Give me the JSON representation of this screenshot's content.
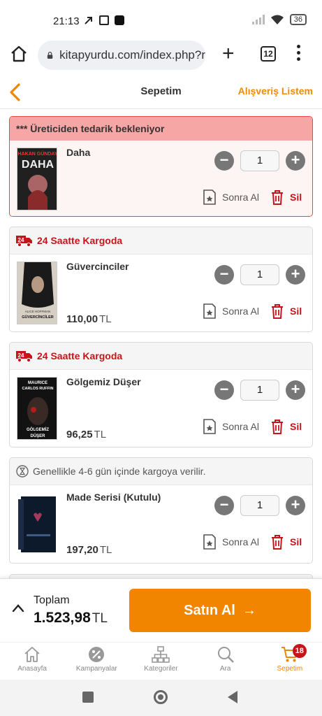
{
  "status_bar": {
    "time": "21:13",
    "battery": "36"
  },
  "browser": {
    "url": "kitapyurdu.com/index.php?r",
    "tab_count": "12"
  },
  "header": {
    "title": "Sepetim",
    "wishlist": "Alışveriş Listem"
  },
  "cart": {
    "items": [
      {
        "notice": "*** Üreticiden tedarik bekleniyor",
        "title": "Daha",
        "price": "",
        "currency": "",
        "qty": "1",
        "later": "Sonra Al",
        "delete": "Sil",
        "cover_lines": [
          "HAKAN GÜNDAY",
          "DAHA"
        ]
      },
      {
        "notice": "24 Saatte Kargoda",
        "title": "Güvercinciler",
        "price": "110,00",
        "currency": "TL",
        "qty": "1",
        "later": "Sonra Al",
        "delete": "Sil",
        "cover_lines": [
          "ALICE HOFFMAN",
          "GÜVERCİNCİLER"
        ]
      },
      {
        "notice": "24 Saatte Kargoda",
        "title": "Gölgemiz Düşer",
        "price": "96,25",
        "currency": "TL",
        "qty": "1",
        "later": "Sonra Al",
        "delete": "Sil",
        "cover_lines": [
          "MAURICE",
          "CARLOS RUFFIN",
          "GÖLGEMİZ",
          "DÜŞER"
        ]
      },
      {
        "notice": "Genellikle 4-6 gün içinde kargoya verilir.",
        "title": "Made Serisi (Kutulu)",
        "price": "197,20",
        "currency": "TL",
        "qty": "1",
        "later": "Sonra Al",
        "delete": "Sil",
        "cover_lines": []
      }
    ]
  },
  "total": {
    "label": "Toplam",
    "value": "1.523,98",
    "currency": "TL"
  },
  "buy_button": {
    "label": "Satın Al",
    "arrow": "→"
  },
  "bottom_nav": {
    "items": [
      {
        "label": "Anasayfa",
        "icon": "home-icon"
      },
      {
        "label": "Kampanyalar",
        "icon": "percent-badge-icon"
      },
      {
        "label": "Kategoriler",
        "icon": "sitemap-icon"
      },
      {
        "label": "Ara",
        "icon": "search-icon"
      },
      {
        "label": "Sepetim",
        "icon": "cart-icon",
        "badge": "18"
      }
    ]
  },
  "colors": {
    "accent": "#f28500",
    "danger": "#c7141a",
    "alert_bg": "#f7a6a6"
  }
}
